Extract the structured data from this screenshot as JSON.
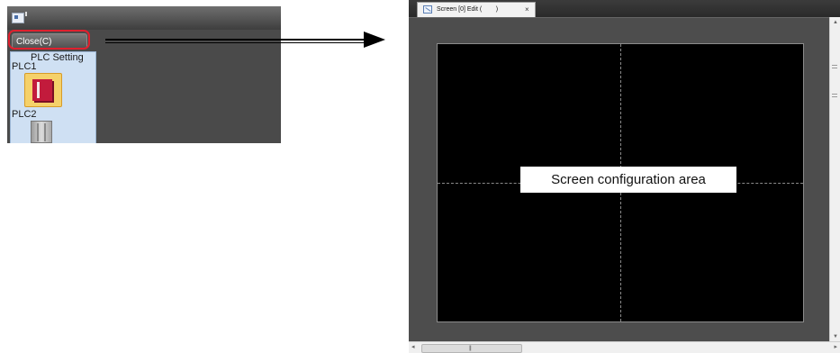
{
  "left_panel": {
    "close_label": "Close(C)",
    "plc_setting_label": "PLC Setting",
    "plc1_label": "PLC1",
    "plc2_label": "PLC2",
    "highlight_color": "#e0202e"
  },
  "editor": {
    "tab_title": "Screen [0] Edit (        )",
    "tab_close": "×",
    "screen_label": "Screen configuration area"
  }
}
